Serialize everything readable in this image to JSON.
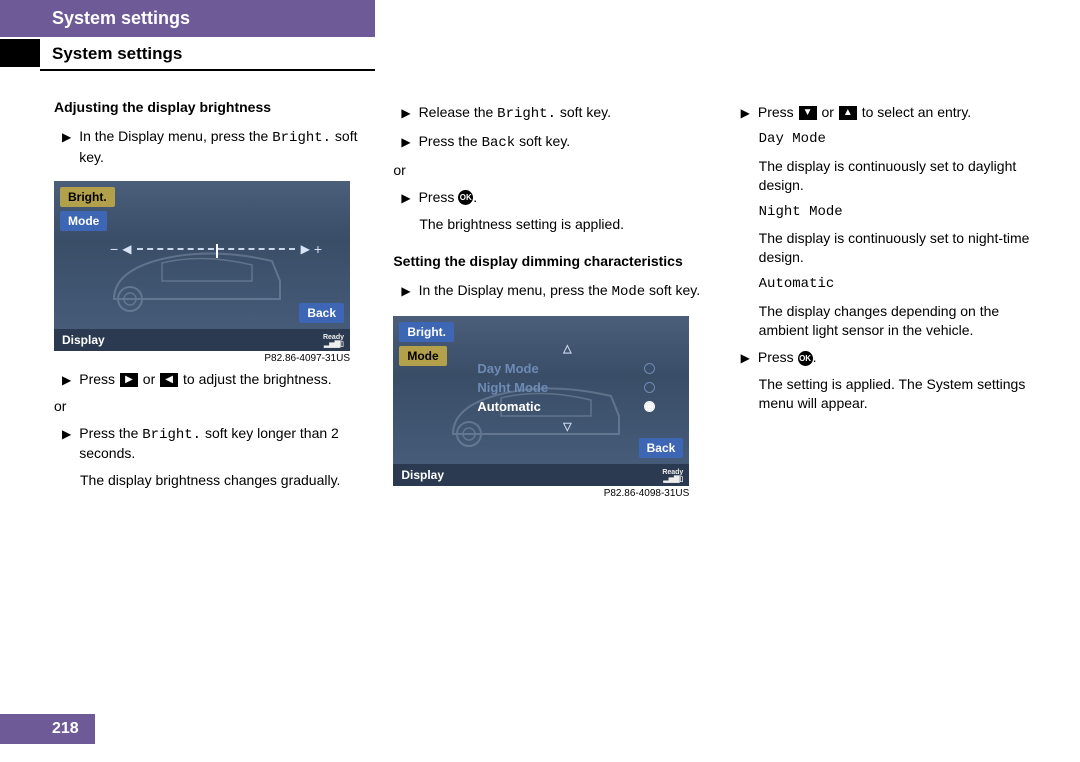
{
  "header": {
    "tab": "System settings",
    "section": "System settings"
  },
  "page_number": "218",
  "col1": {
    "title": "Adjusting the display brightness",
    "bullet1_a": "In the Display menu, press the ",
    "bullet1_mono": "Bright.",
    "bullet1_b": " soft key.",
    "fig_caption": "P82.86-4097-31US",
    "bullet2_a": "Press ",
    "bullet2_b": " or ",
    "bullet2_c": " to adjust the brightness.",
    "or": "or",
    "bullet3_a": "Press the ",
    "bullet3_mono": "Bright.",
    "bullet3_b": " soft key longer than 2 seconds.",
    "plain4": "The display brightness changes gradually.",
    "screen": {
      "bright": "Bright.",
      "mode": "Mode",
      "back": "Back",
      "display": "Display",
      "ready": "Ready",
      "signal": "▂▅▇▯"
    }
  },
  "col2": {
    "bullet1_a": "Release the ",
    "bullet1_mono": "Bright.",
    "bullet1_b": " soft key.",
    "bullet2_a": "Press the ",
    "bullet2_mono": "Back",
    "bullet2_b": " soft key.",
    "or": "or",
    "bullet3": "Press ",
    "bullet3_b": ".",
    "plain3": "The brightness setting is applied.",
    "title2": "Setting the display dimming characteristics",
    "bullet4_a": "In the Display menu, press the ",
    "bullet4_mono": "Mode",
    "bullet4_b": " soft key.",
    "fig_caption": "P82.86-4098-31US",
    "screen": {
      "bright": "Bright.",
      "mode": "Mode",
      "back": "Back",
      "display": "Display",
      "ready": "Ready",
      "signal": "▂▅▇▯",
      "opt1": "Day Mode",
      "opt2": "Night Mode",
      "opt3": "Automatic"
    }
  },
  "col3": {
    "bullet1_a": "Press ",
    "bullet1_b": " or ",
    "bullet1_c": " to select an entry.",
    "mode1": "Day Mode",
    "mode1_desc": "The display is continuously set to daylight design.",
    "mode2": "Night Mode",
    "mode2_desc": "The display is continuously set to night-time design.",
    "mode3": "Automatic",
    "mode3_desc": "The display changes depending on the ambient light sensor in the vehicle.",
    "bullet2": "Press ",
    "bullet2_b": ".",
    "plain2": "The setting is applied. The System settings menu will appear."
  }
}
